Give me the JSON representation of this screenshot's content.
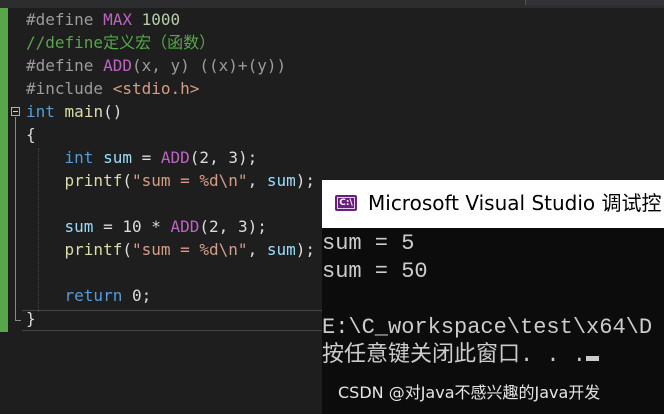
{
  "editor": {
    "lines": [
      {
        "tokens": [
          {
            "t": "#define ",
            "c": "pp"
          },
          {
            "t": "MAX",
            "c": "mac"
          },
          {
            "t": " ",
            "c": "plain"
          },
          {
            "t": "1000",
            "c": "num"
          }
        ]
      },
      {
        "tokens": [
          {
            "t": "//define定义宏（函数）",
            "c": "cmt"
          }
        ]
      },
      {
        "tokens": [
          {
            "t": "#define ",
            "c": "pp"
          },
          {
            "t": "ADD",
            "c": "mac"
          },
          {
            "t": "(x, y) ((x)+(y))",
            "c": "pp"
          }
        ]
      },
      {
        "tokens": [
          {
            "t": "#include ",
            "c": "pp"
          },
          {
            "t": "<stdio.h>",
            "c": "str"
          }
        ]
      },
      {
        "tokens": [
          {
            "t": "int",
            "c": "kw"
          },
          {
            "t": " ",
            "c": "plain"
          },
          {
            "t": "main",
            "c": "fn"
          },
          {
            "t": "()",
            "c": "plain"
          }
        ]
      },
      {
        "tokens": [
          {
            "t": "{",
            "c": "plain"
          }
        ]
      },
      {
        "tokens": [
          {
            "t": "    ",
            "c": "plain"
          },
          {
            "t": "int",
            "c": "kw"
          },
          {
            "t": " ",
            "c": "plain"
          },
          {
            "t": "sum",
            "c": "var"
          },
          {
            "t": " = ",
            "c": "plain"
          },
          {
            "t": "ADD",
            "c": "mac"
          },
          {
            "t": "(2, 3);",
            "c": "plain"
          }
        ]
      },
      {
        "tokens": [
          {
            "t": "    ",
            "c": "plain"
          },
          {
            "t": "printf",
            "c": "fn"
          },
          {
            "t": "(",
            "c": "plain"
          },
          {
            "t": "\"sum = %d\\n\"",
            "c": "str"
          },
          {
            "t": ", ",
            "c": "plain"
          },
          {
            "t": "sum",
            "c": "var"
          },
          {
            "t": ");",
            "c": "plain"
          }
        ]
      },
      {
        "tokens": []
      },
      {
        "tokens": [
          {
            "t": "    ",
            "c": "plain"
          },
          {
            "t": "sum",
            "c": "var"
          },
          {
            "t": " = 10 * ",
            "c": "plain"
          },
          {
            "t": "ADD",
            "c": "mac"
          },
          {
            "t": "(2, 3);",
            "c": "plain"
          }
        ]
      },
      {
        "tokens": [
          {
            "t": "    ",
            "c": "plain"
          },
          {
            "t": "printf",
            "c": "fn"
          },
          {
            "t": "(",
            "c": "plain"
          },
          {
            "t": "\"sum = %d\\n\"",
            "c": "str"
          },
          {
            "t": ", ",
            "c": "plain"
          },
          {
            "t": "sum",
            "c": "var"
          },
          {
            "t": ");",
            "c": "plain"
          }
        ]
      },
      {
        "tokens": []
      },
      {
        "tokens": [
          {
            "t": "    ",
            "c": "plain"
          },
          {
            "t": "return",
            "c": "kw"
          },
          {
            "t": " 0;",
            "c": "plain"
          }
        ]
      },
      {
        "tokens": [
          {
            "t": "}",
            "c": "plain"
          }
        ]
      }
    ]
  },
  "console": {
    "icon_label": "C:\\",
    "title": "Microsoft Visual Studio 调试控",
    "lines": [
      "sum = 5",
      "sum = 50",
      "",
      "E:\\C_workspace\\test\\x64\\D",
      "按任意键关闭此窗口. . ."
    ]
  },
  "watermark": "CSDN @对Java不感兴趣的Java开发",
  "colors": {
    "keyword": "#569cd6",
    "macro": "#bd63c5",
    "string": "#d69d85",
    "comment": "#57a64a",
    "function": "#dcdcaa",
    "variable": "#9cdcfe",
    "number": "#b5cea8",
    "change_bar": "#57a64a",
    "console_icon": "#68217a"
  }
}
